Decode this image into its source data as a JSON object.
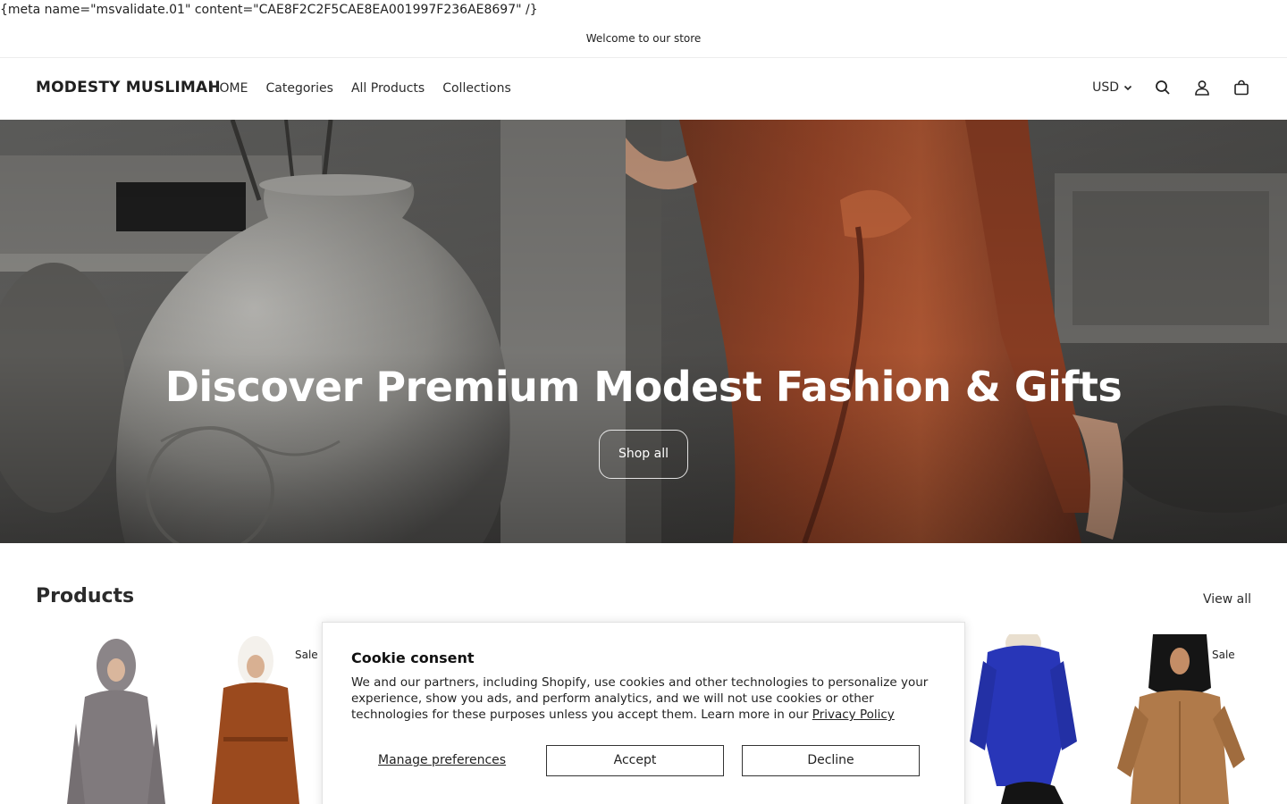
{
  "meta_line": "{meta name=\"msvalidate.01\" content=\"CAE8F2C2F5CAE8EA001997F236AE8697\" /}",
  "announcement": "Welcome to our store",
  "header": {
    "brand": "MODESTY MUSLIMAH",
    "nav": [
      "HOME",
      "Categories",
      "All Products",
      "Collections"
    ],
    "currency": "USD",
    "icons": [
      "search-icon",
      "account-icon",
      "cart-icon"
    ]
  },
  "hero": {
    "title": "Discover Premium Modest Fashion & Gifts",
    "button": "Shop all"
  },
  "products": {
    "title": "Products",
    "view_all": "View all",
    "badges": [
      "Sale",
      "Sale"
    ]
  },
  "cookie": {
    "title": "Cookie consent",
    "text": "We and our partners, including Shopify, use cookies and other technologies to personalize your experience, show you ads, and perform analytics, and we will not use cookies or other technologies for these purposes unless you accept them. Learn more in our ",
    "link": "Privacy Policy",
    "manage": "Manage preferences",
    "accept": "Accept",
    "decline": "Decline"
  }
}
